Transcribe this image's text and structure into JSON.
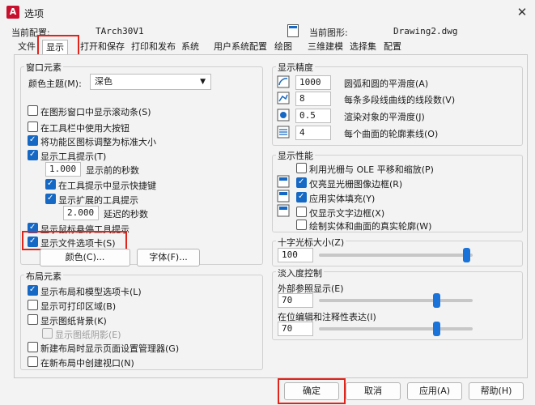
{
  "window": {
    "title": "选项",
    "close": "✕"
  },
  "profile": {
    "label": "当前配置:",
    "value": "TArch30V1"
  },
  "drawing": {
    "label": "当前图形:",
    "value": "Drawing2.dwg"
  },
  "tabs": [
    "文件",
    "显示",
    "打开和保存",
    "打印和发布",
    "系统",
    "用户系统配置",
    "绘图",
    "三维建模",
    "选择集",
    "配置"
  ],
  "window_elements": {
    "title": "窗口元素",
    "color_theme_label": "颜色主题(M):",
    "color_theme_value": "深色",
    "checks": [
      {
        "label": "在图形窗口中显示滚动条(S)",
        "checked": false
      },
      {
        "label": "在工具栏中使用大按钮",
        "checked": false
      },
      {
        "label": "将功能区图标调整为标准大小",
        "checked": true
      },
      {
        "label": "显示工具提示(T)",
        "checked": true
      }
    ],
    "delay_value": "1.000",
    "delay_label": "显示前的秒数",
    "sub_checks": [
      {
        "label": "在工具提示中显示快捷键",
        "checked": true
      },
      {
        "label": "显示扩展的工具提示",
        "checked": true
      }
    ],
    "ext_delay_value": "2.000",
    "ext_delay_label": "延迟的秒数",
    "checks2": [
      {
        "label": "显示鼠标悬停工具提示",
        "checked": true
      },
      {
        "label": "显示文件选项卡(S)",
        "checked": true
      }
    ],
    "colors_button": "颜色(C)...",
    "fonts_button": "字体(F)..."
  },
  "layout_elements": {
    "title": "布局元素",
    "checks": [
      {
        "label": "显示布局和模型选项卡(L)",
        "checked": true
      },
      {
        "label": "显示可打印区域(B)",
        "checked": false
      },
      {
        "label": "显示图纸背景(K)",
        "checked": false
      },
      {
        "label": "显示图纸阴影(E)",
        "checked": false,
        "disabled": true
      },
      {
        "label": "新建布局时显示页面设置管理器(G)",
        "checked": false
      },
      {
        "label": "在新布局中创建视口(N)",
        "checked": false
      }
    ]
  },
  "resolution": {
    "title": "显示精度",
    "rows": [
      {
        "value": "1000",
        "label": "圆弧和圆的平滑度(A)"
      },
      {
        "value": "8",
        "label": "每条多段线曲线的线段数(V)"
      },
      {
        "value": "0.5",
        "label": "渲染对象的平滑度(J)"
      },
      {
        "value": "4",
        "label": "每个曲面的轮廓素线(O)"
      }
    ]
  },
  "performance": {
    "title": "显示性能",
    "checks": [
      {
        "label": "利用光栅与 OLE 平移和缩放(P)",
        "checked": false
      },
      {
        "label": "仅亮显光栅图像边框(R)",
        "checked": true
      },
      {
        "label": "应用实体填充(Y)",
        "checked": true
      },
      {
        "label": "仅显示文字边框(X)",
        "checked": false
      },
      {
        "label": "绘制实体和曲面的真实轮廓(W)",
        "checked": false
      }
    ]
  },
  "crosshair": {
    "title": "十字光标大小(Z)",
    "value": "100",
    "level_fraction": 1.0
  },
  "fade": {
    "title": "淡入度控制",
    "xref_label": "外部参照显示(E)",
    "xref_value": "70",
    "inplace_label": "在位编辑和注释性表达(I)",
    "inplace_value": "70"
  },
  "buttons": {
    "ok": "确定",
    "cancel": "取消",
    "apply": "应用(A)",
    "help": "帮助(H)"
  },
  "colors": {
    "accent": "#1668c5",
    "highlight": "#e0231b"
  }
}
